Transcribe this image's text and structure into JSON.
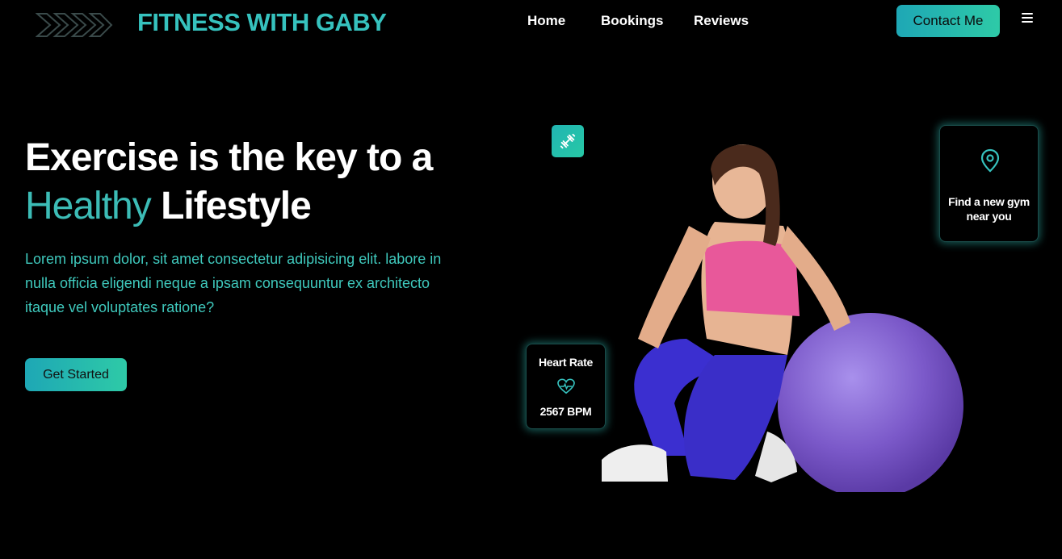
{
  "header": {
    "brand": "FITNESS WITH GABY",
    "logo_icon": "chevron-arrows-icon",
    "nav": [
      {
        "label": "Home"
      },
      {
        "label": "Bookings"
      },
      {
        "label": "Reviews"
      }
    ],
    "contact_label": "Contact Me",
    "menu_icon": "hamburger-menu-icon"
  },
  "hero": {
    "headline_line1": "Exercise is the key to a",
    "headline_accent": "Healthy",
    "headline_rest": " Lifestyle",
    "description": "Lorem ipsum dolor, sit amet consectetur adipisicing elit. labore in nulla officia eligendi neque a ipsam consequuntur ex architecto itaque vel voluptates ratione?",
    "cta_label": "Get Started"
  },
  "cards": {
    "gym": {
      "text": "Find a new gym near you",
      "icon": "map-pin-icon"
    },
    "heart": {
      "label": "Heart Rate",
      "value": "2567 BPM",
      "icon": "heart-pulse-icon"
    },
    "badge_icon": "dumbbell-icon"
  },
  "colors": {
    "accent": "#36c2be",
    "button_gradient_start": "#1ea7b5",
    "button_gradient_end": "#2ecaa7",
    "background": "#000000"
  }
}
